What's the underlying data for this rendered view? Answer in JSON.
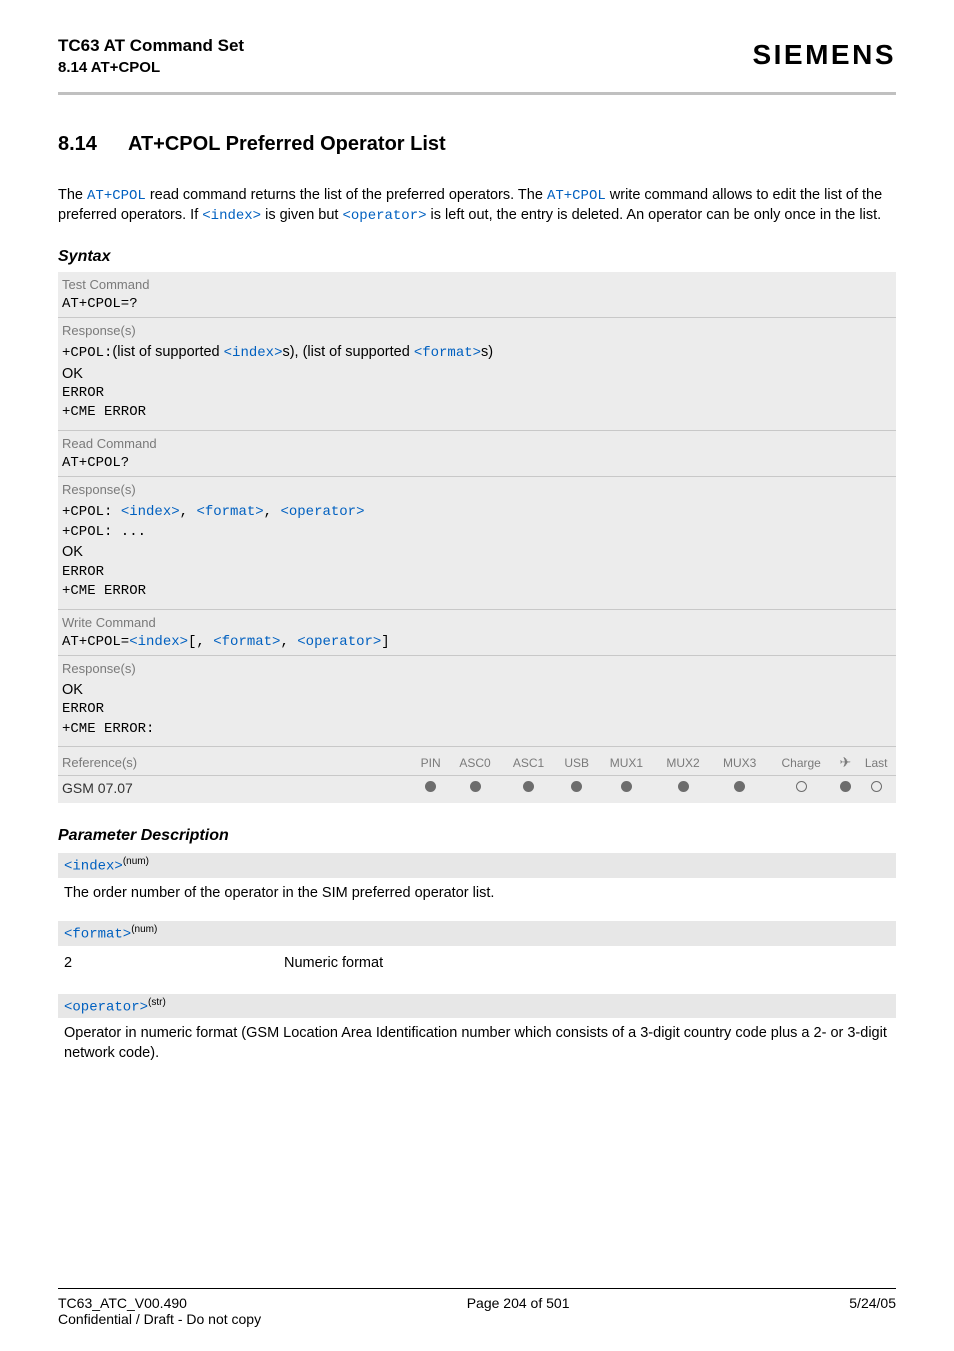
{
  "header": {
    "title": "TC63 AT Command Set",
    "sub": "8.14 AT+CPOL",
    "brand": "SIEMENS"
  },
  "section": {
    "num": "8.14",
    "title": "AT+CPOL   Preferred Operator List"
  },
  "intro": {
    "p1a": "The ",
    "cmd1": "AT+CPOL",
    "p1b": " read command returns the list of the preferred operators. The ",
    "cmd2": "AT+CPOL",
    "p1c": " write command allows to edit the list of the preferred operators. If ",
    "tok_index": "<index>",
    "p1d": " is given but ",
    "tok_operator": "<operator>",
    "p1e": " is left out, the entry is deleted. An operator can be only once in the list."
  },
  "syntax_label": "Syntax",
  "blocks": {
    "test": {
      "lbl": "Test Command",
      "cmd": "AT+CPOL=?",
      "resp_lbl": "Response(s)",
      "r1a": "+CPOL:",
      "r1b": "(list of supported ",
      "r1_idx": "<index>",
      "r1c": "s), (list of supported ",
      "r1_fmt": "<format>",
      "r1d": "s)",
      "r2": "OK",
      "r3": "ERROR",
      "r4": "+CME ERROR"
    },
    "read": {
      "lbl": "Read Command",
      "cmd": "AT+CPOL?",
      "resp_lbl": "Response(s)",
      "r1a": "+CPOL: ",
      "r1_idx": "<index>",
      "r1_c1": ", ",
      "r1_fmt": "<format>",
      "r1_c2": ", ",
      "r1_op": "<operator>",
      "r2": "+CPOL: ...",
      "r3": "OK",
      "r4": "ERROR",
      "r5": "+CME ERROR"
    },
    "write": {
      "lbl": "Write Command",
      "cmd_a": "AT+CPOL=",
      "cmd_idx": "<index>",
      "cmd_b": "[, ",
      "cmd_fmt": "<format>",
      "cmd_c": ", ",
      "cmd_op": "<operator>",
      "cmd_d": "]",
      "resp_lbl": "Response(s)",
      "r1": "OK",
      "r2": "ERROR",
      "r3": "+CME ERROR:"
    }
  },
  "reftable": {
    "ref_lbl": "Reference(s)",
    "cols": [
      "PIN",
      "ASC0",
      "ASC1",
      "USB",
      "MUX1",
      "MUX2",
      "MUX3",
      "Charge",
      "✈",
      "Last"
    ],
    "ref_val": "GSM 07.07",
    "vals": [
      "filled",
      "filled",
      "filled",
      "filled",
      "filled",
      "filled",
      "filled",
      "open",
      "filled",
      "open"
    ]
  },
  "param_label": "Parameter Description",
  "params": {
    "index": {
      "name": "<index>",
      "type": "(num)",
      "desc": "The order number of the operator in the SIM preferred operator list."
    },
    "format": {
      "name": "<format>",
      "type": "(num)",
      "key": "2",
      "val": "Numeric format"
    },
    "operator": {
      "name": "<operator>",
      "type": "(str)",
      "desc": "Operator in numeric format (GSM Location Area Identification number which consists of a 3-digit country code plus a 2- or 3-digit network code)."
    }
  },
  "footer": {
    "left": "TC63_ATC_V00.490",
    "center": "Page 204 of 501",
    "right": "5/24/05",
    "conf": "Confidential / Draft - Do not copy"
  }
}
